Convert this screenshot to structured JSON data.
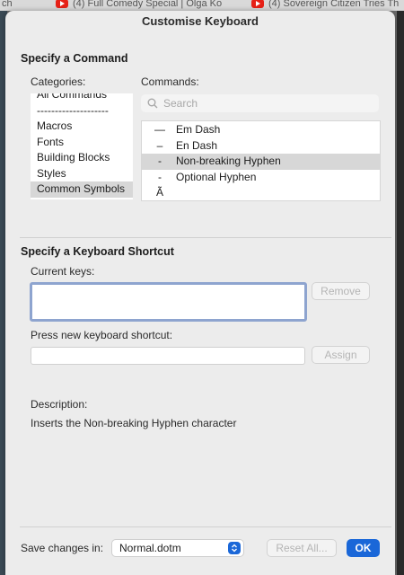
{
  "background": {
    "tabs": [
      {
        "label": "ch"
      },
      {
        "label": "(4) Full Comedy Special | Olga Ko"
      },
      {
        "label": "(4) Sovereign Citizen Tries Th"
      }
    ]
  },
  "dialog": {
    "title": "Customise Keyboard",
    "command_section": {
      "title": "Specify a Command",
      "categories_label": "Categories:",
      "commands_label": "Commands:",
      "search_placeholder": "Search",
      "categories": [
        {
          "label": "All Commands"
        },
        {
          "label": "--------------------"
        },
        {
          "label": "Macros"
        },
        {
          "label": "Fonts"
        },
        {
          "label": "Building Blocks"
        },
        {
          "label": "Styles"
        },
        {
          "label": "Common Symbols",
          "selected": true
        }
      ],
      "commands": [
        {
          "symbol": "—",
          "label": "Em Dash"
        },
        {
          "symbol": "–",
          "label": "En Dash"
        },
        {
          "symbol": "-",
          "label": "Non-breaking Hyphen",
          "selected": true
        },
        {
          "symbol": "-",
          "label": "Optional Hyphen"
        },
        {
          "symbol": "Ã",
          "label": ""
        }
      ]
    },
    "shortcut_section": {
      "title": "Specify a Keyboard Shortcut",
      "current_keys_label": "Current keys:",
      "remove_label": "Remove",
      "press_label": "Press new keyboard shortcut:",
      "assign_label": "Assign"
    },
    "description": {
      "label": "Description:",
      "text": "Inserts the Non-breaking Hyphen character"
    },
    "footer": {
      "save_in_label": "Save changes in:",
      "save_in_value": "Normal.dotm",
      "reset_label": "Reset All...",
      "ok_label": "OK"
    }
  },
  "colors": {
    "accent": "#1a67d8",
    "selection": "#d7d7d7",
    "focus_ring": "#8ea4cf",
    "youtube_red": "#e62117"
  }
}
